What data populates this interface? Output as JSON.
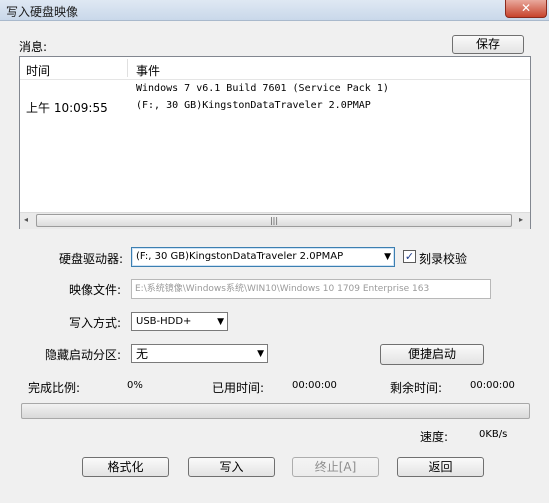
{
  "window": {
    "title": "写入硬盘映像",
    "close_glyph": "✕"
  },
  "messages": {
    "label": "消息:",
    "save_label": "保存",
    "columns": {
      "time": "时间",
      "event": "事件"
    },
    "row": {
      "time": "上午 10:09:55",
      "line1": "Windows 7 v6.1 Build 7601 (Service Pack 1)",
      "line2": "(F:, 30 GB)KingstonDataTraveler 2.0PMAP"
    },
    "scroll": {
      "left_arrow": "◂",
      "right_arrow": "▸",
      "grip": "|||"
    }
  },
  "form": {
    "drive_label": "硬盘驱动器:",
    "drive_value": "(F:, 30 GB)KingstonDataTraveler 2.0PMAP",
    "verify_label": "刻录校验",
    "verify_checked": true,
    "image_label": "映像文件:",
    "image_value": "E:\\系统镜像\\Windows系统\\WIN10\\Windows 10 1709 Enterprise 163",
    "write_mode_label": "写入方式:",
    "write_mode_value": "USB-HDD+",
    "hidden_partition_label": "隐藏启动分区:",
    "hidden_partition_value": "无",
    "quick_boot_label": "便捷启动",
    "dropdown_glyph": "▼"
  },
  "status": {
    "percent_label": "完成比例:",
    "percent_value": "0%",
    "elapsed_label": "已用时间:",
    "elapsed_value": "00:00:00",
    "remaining_label": "剩余时间:",
    "remaining_value": "00:00:00",
    "progress_fraction": 0,
    "speed_label": "速度:",
    "speed_value": "0KB/s"
  },
  "actions": {
    "format_label": "格式化",
    "write_label": "写入",
    "abort_label": "终止[A]",
    "back_label": "返回"
  }
}
